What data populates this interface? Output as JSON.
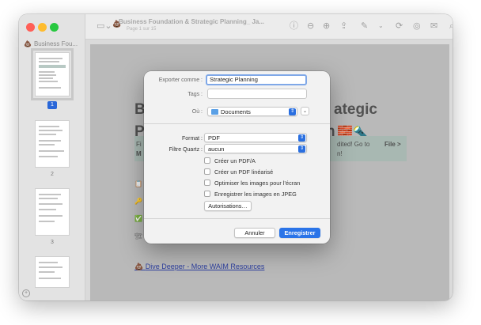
{
  "window": {
    "sidebar_doc_label": "Business Fou...",
    "doc_title": "Business Foundation & Strategic Planning_ Ja...",
    "doc_subtitle": "Page 1 sur 15",
    "page_numbers": [
      "1",
      "2",
      "3"
    ]
  },
  "page_content": {
    "heading_line1_start": "B",
    "heading_line1_end": "ategic",
    "heading_line2_start": "P",
    "heading_line2_end": "n",
    "heading_emojis": "🧱🔦",
    "tealbox_line1_start": "Fi",
    "tealbox_line1_end": "dited! Go to",
    "tealbox_file": "File >",
    "tealbox_line2_start": "M",
    "tealbox_line2_end": "n!",
    "link_text": "Dive Deeper - More WAIM Resources"
  },
  "dialog": {
    "export_as_label": "Exporter comme :",
    "export_as_value": "Strategic Planning",
    "tags_label": "Tags :",
    "tags_value": "",
    "where_label": "Où :",
    "where_value": "Documents",
    "format_label": "Format :",
    "format_value": "PDF",
    "quartz_label": "Filtre Quartz :",
    "quartz_value": "aucun",
    "checkboxes": [
      "Créer un PDF/A",
      "Créer un PDF linéarisé",
      "Optimiser les images pour l’écran",
      "Enregistrer les images en JPEG"
    ],
    "permissions_button": "Autorisations…",
    "cancel_button": "Annuler",
    "save_button": "Enregistrer"
  },
  "colors": {
    "accent": "#2a74e8",
    "close": "#ff5f57",
    "minimize": "#febc2e",
    "maximize": "#28c840"
  }
}
